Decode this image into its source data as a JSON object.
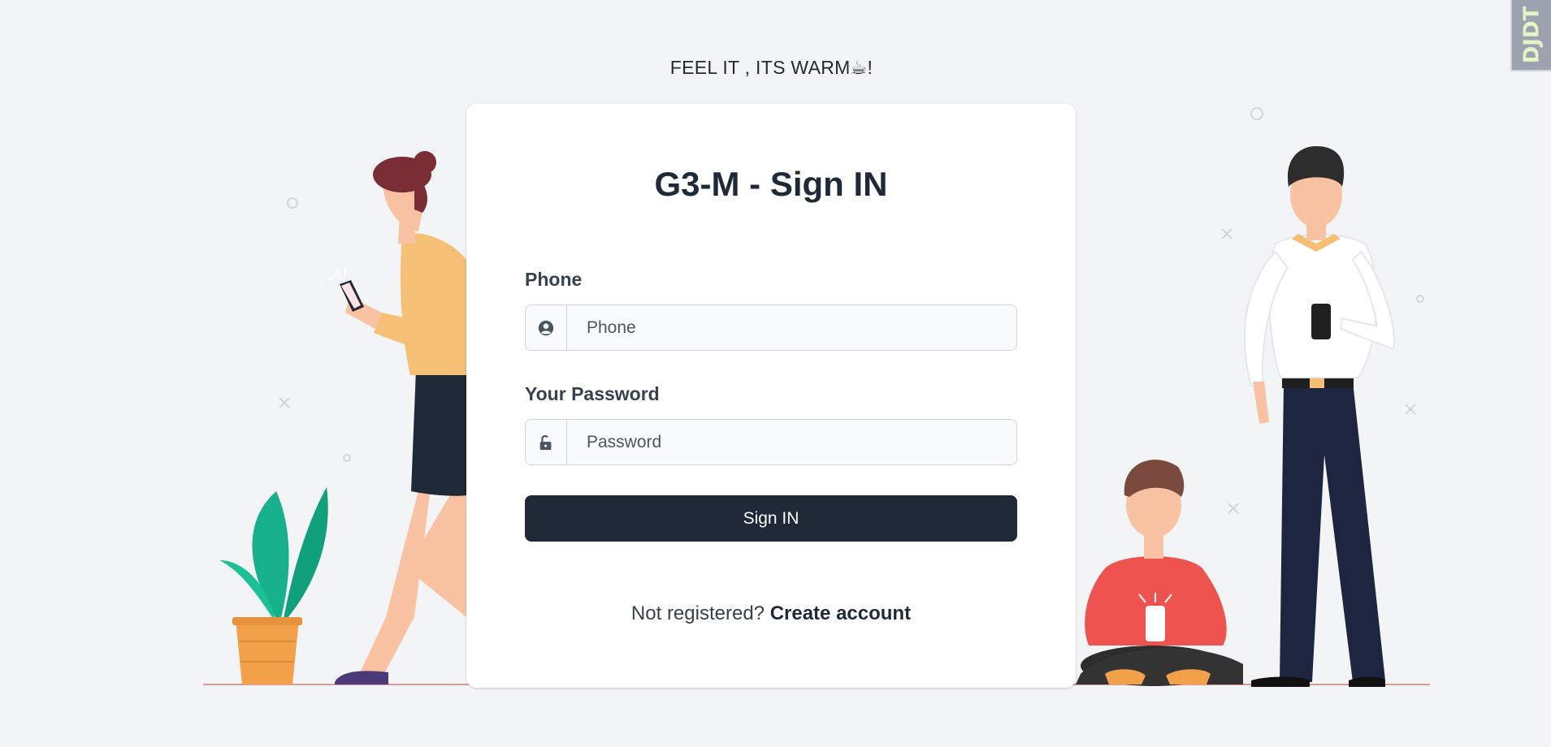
{
  "tagline": "FEEL IT , ITS WARM☕!",
  "badge": "DJDT",
  "card": {
    "title": "G3-M - Sign IN",
    "phone": {
      "label": "Phone",
      "placeholder": "Phone",
      "value": "",
      "icon": "user-circle-icon"
    },
    "password": {
      "label": "Your Password",
      "placeholder": "Password",
      "value": "",
      "icon": "lock-open-icon"
    },
    "submit_label": "Sign IN",
    "register_prompt": "Not registered?",
    "register_link": "Create account"
  },
  "colors": {
    "background": "#f3f4f6",
    "primary": "#1f2937",
    "card": "#ffffff",
    "plant_leaf": "#16b08a",
    "pot": "#f3a04a",
    "shirt_red": "#ef5350",
    "top_yellow": "#f5bf76"
  }
}
